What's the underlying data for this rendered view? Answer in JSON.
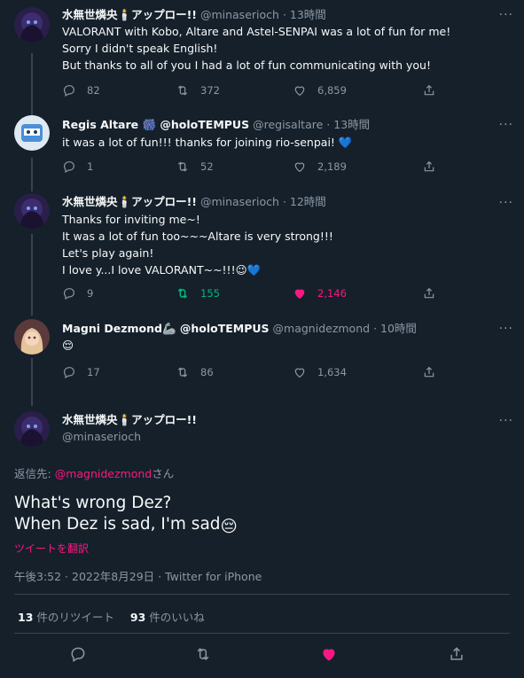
{
  "thread": [
    {
      "display_name": "水無世燐央🕯️アップロー!!",
      "handle": "@minaserioch",
      "time": "13時間",
      "lines": [
        "VALORANT with Kobo, Altare and Astel-SENPAI was a lot of fun for me!",
        "Sorry I didn't speak English!",
        "But thanks to all of you I had a lot of fun communicating with you!"
      ],
      "replies": "82",
      "retweets": "372",
      "likes": "6,859",
      "retweeted": false,
      "liked": false
    },
    {
      "display_name": "Regis Altare 🎆 @holoTEMPUS",
      "handle": "@regisaltare",
      "time": "13時間",
      "lines": [
        "it was a lot of fun!!! thanks for joining rio-senpai! 💙"
      ],
      "replies": "1",
      "retweets": "52",
      "likes": "2,189",
      "retweeted": false,
      "liked": false
    },
    {
      "display_name": "水無世燐央🕯️アップロー!!",
      "handle": "@minaserioch",
      "time": "12時間",
      "lines": [
        "Thanks for inviting me~!",
        "It was a lot of fun too~~~Altare is very strong!!!",
        "Let's play again!",
        "I love y...I love VALORANT~~!!!😉💙"
      ],
      "replies": "9",
      "retweets": "155",
      "likes": "2,146",
      "retweeted": true,
      "liked": true
    },
    {
      "display_name": "Magni Dezmond🦾 @holoTEMPUS",
      "handle": "@magnidezmond",
      "time": "10時間",
      "lines": [
        "😌"
      ],
      "replies": "17",
      "retweets": "86",
      "likes": "1,634",
      "retweeted": false,
      "liked": false
    }
  ],
  "main": {
    "display_name": "水無世燐央🕯️アップロー!!",
    "handle": "@minaserioch",
    "reply_prefix": "返信先: ",
    "reply_to": "@magnidezmond",
    "reply_suffix": "さん",
    "text_line1": "What's wrong Dez?",
    "text_line2": "When Dez is sad, I'm sad",
    "text_emoji": "😔",
    "translate": "ツイートを翻訳",
    "meta": "午後3:52 · 2022年8月29日 · Twitter for iPhone",
    "retweet_count": "13",
    "retweet_label": " 件のリツイート",
    "like_count": "93",
    "like_label": " 件のいいね",
    "liked": true
  },
  "colors": {
    "background": "#15202b",
    "accent_pink": "#f91880",
    "retweet_green": "#00ba7c",
    "muted": "#8b98a5",
    "divider": "#38444d"
  },
  "icons": [
    "reply-icon",
    "retweet-icon",
    "like-icon",
    "share-icon",
    "more-icon"
  ]
}
